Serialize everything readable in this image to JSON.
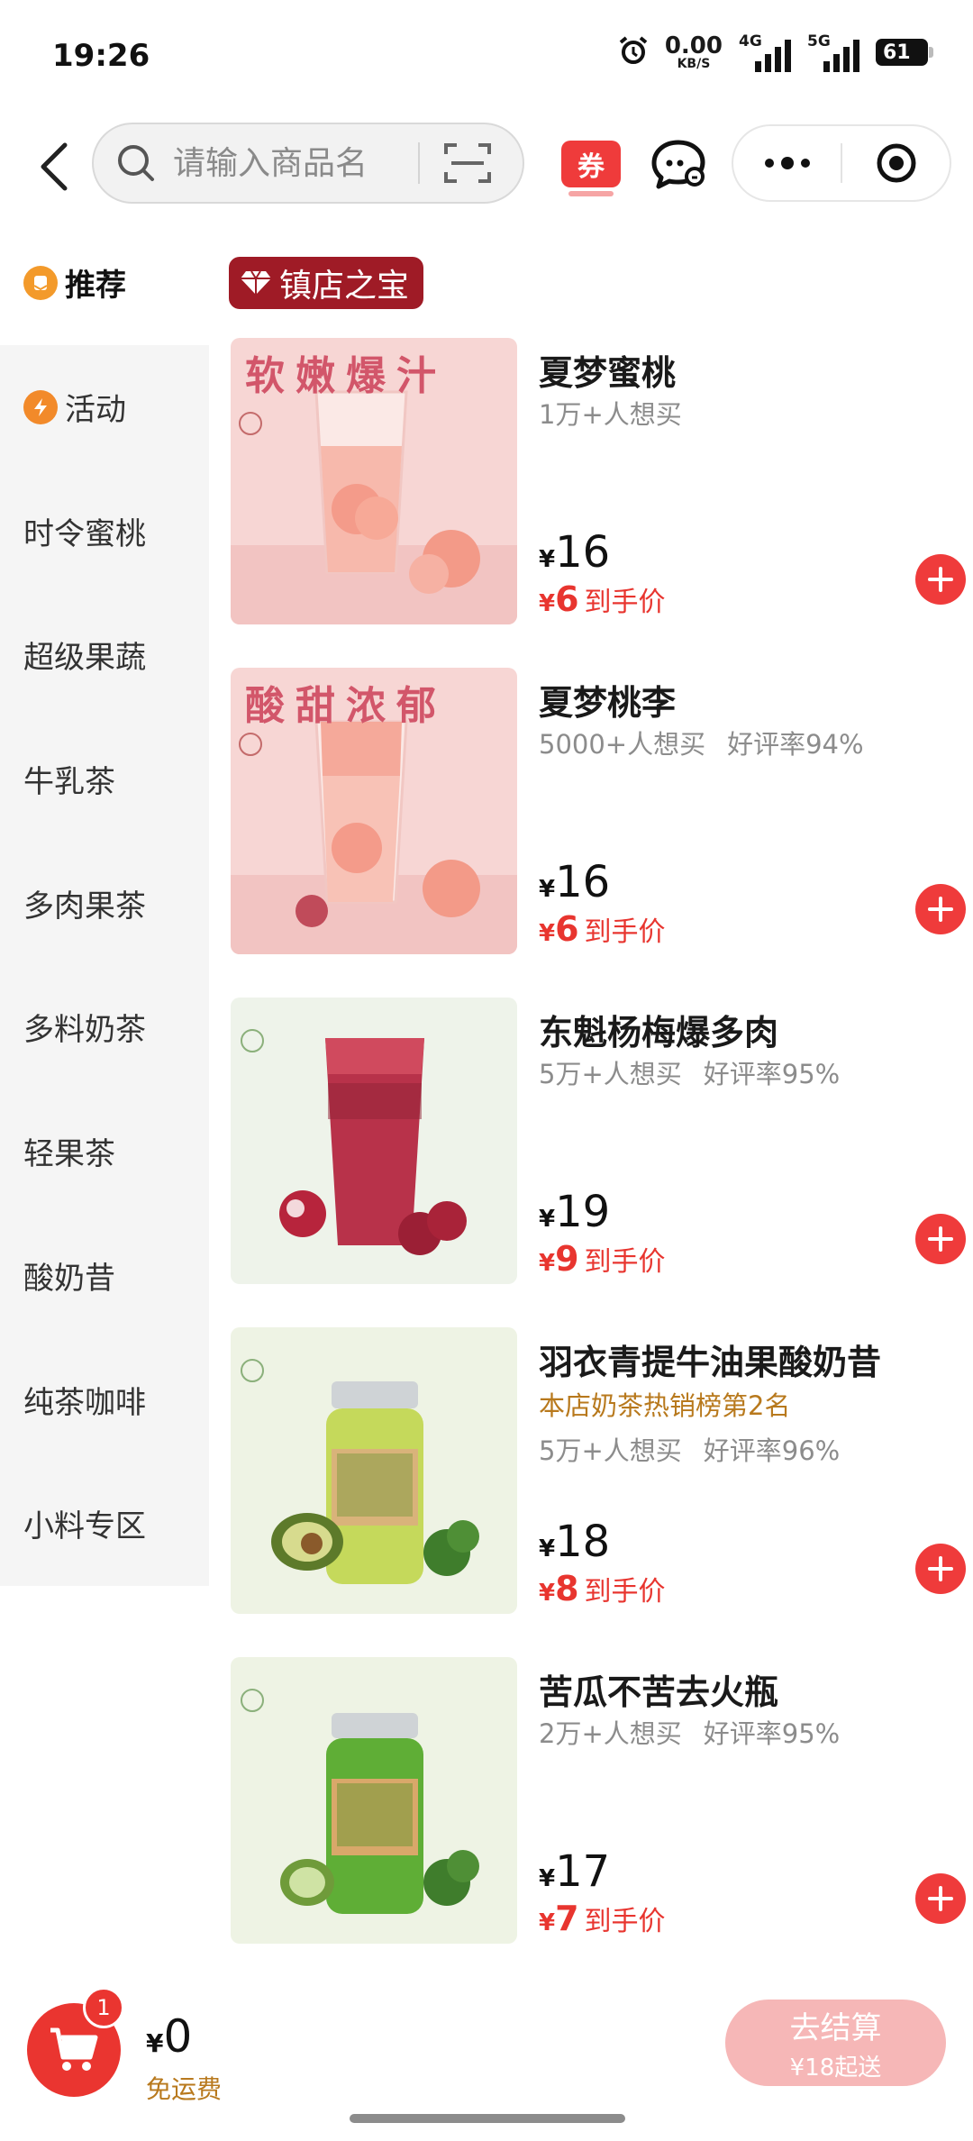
{
  "status_bar": {
    "time": "19:26",
    "net_speed": "0.00",
    "net_unit": "KB/S",
    "sim1_label": "4G",
    "sim2_label": "5G",
    "battery": "61"
  },
  "topnav": {
    "search_placeholder": "请输入商品名",
    "coupon_label": "券"
  },
  "sidebar": {
    "items": [
      {
        "label": "推荐",
        "icon": "recommend-icon",
        "active": true
      },
      {
        "label": "活动",
        "icon": "lightning-icon"
      },
      {
        "label": "时令蜜桃"
      },
      {
        "label": "超级果蔬"
      },
      {
        "label": "牛乳茶"
      },
      {
        "label": "多肉果茶"
      },
      {
        "label": "多料奶茶"
      },
      {
        "label": "轻果茶"
      },
      {
        "label": "酸奶昔"
      },
      {
        "label": "纯茶咖啡"
      },
      {
        "label": "小料专区"
      }
    ]
  },
  "section": {
    "badge": "镇店之宝"
  },
  "products": [
    {
      "name": "夏梦蜜桃",
      "sales": "1万+人想买",
      "rating": "",
      "rank": "",
      "currency": "¥",
      "price": "16",
      "final_price": "6",
      "final_label": "到手价",
      "image_caption": "软嫩爆汁",
      "image_bg": "#f7d6d4"
    },
    {
      "name": "夏梦桃李",
      "sales": "5000+人想买",
      "rating": "好评率94%",
      "rank": "",
      "currency": "¥",
      "price": "16",
      "final_price": "6",
      "final_label": "到手价",
      "image_caption": "酸甜浓郁",
      "image_bg": "#f7d6d4"
    },
    {
      "name": "东魁杨梅爆多肉",
      "sales": "5万+人想买",
      "rating": "好评率95%",
      "rank": "",
      "currency": "¥",
      "price": "19",
      "final_price": "9",
      "final_label": "到手价",
      "image_caption": "",
      "image_bg": "#eef3ea"
    },
    {
      "name": "羽衣青提牛油果酸奶昔",
      "sales": "5万+人想买",
      "rating": "好评率96%",
      "rank": "本店奶茶热销榜第2名",
      "currency": "¥",
      "price": "18",
      "final_price": "8",
      "final_label": "到手价",
      "image_caption": "",
      "image_bg": "#eef3e4"
    },
    {
      "name": "苦瓜不苦去火瓶",
      "sales": "2万+人想买",
      "rating": "好评率95%",
      "rank": "",
      "currency": "¥",
      "price": "17",
      "final_price": "7",
      "final_label": "到手价",
      "image_caption": "",
      "image_bg": "#eef3e4"
    }
  ],
  "bottom_bar": {
    "cart_count": "1",
    "currency": "¥",
    "total": "0",
    "shipping_note": "免运费",
    "checkout_label": "去结算",
    "min_order": "¥18起送"
  },
  "colors": {
    "accent": "#ef3b3b",
    "badge": "#9f1b26",
    "rank_gold": "#b8791d"
  }
}
